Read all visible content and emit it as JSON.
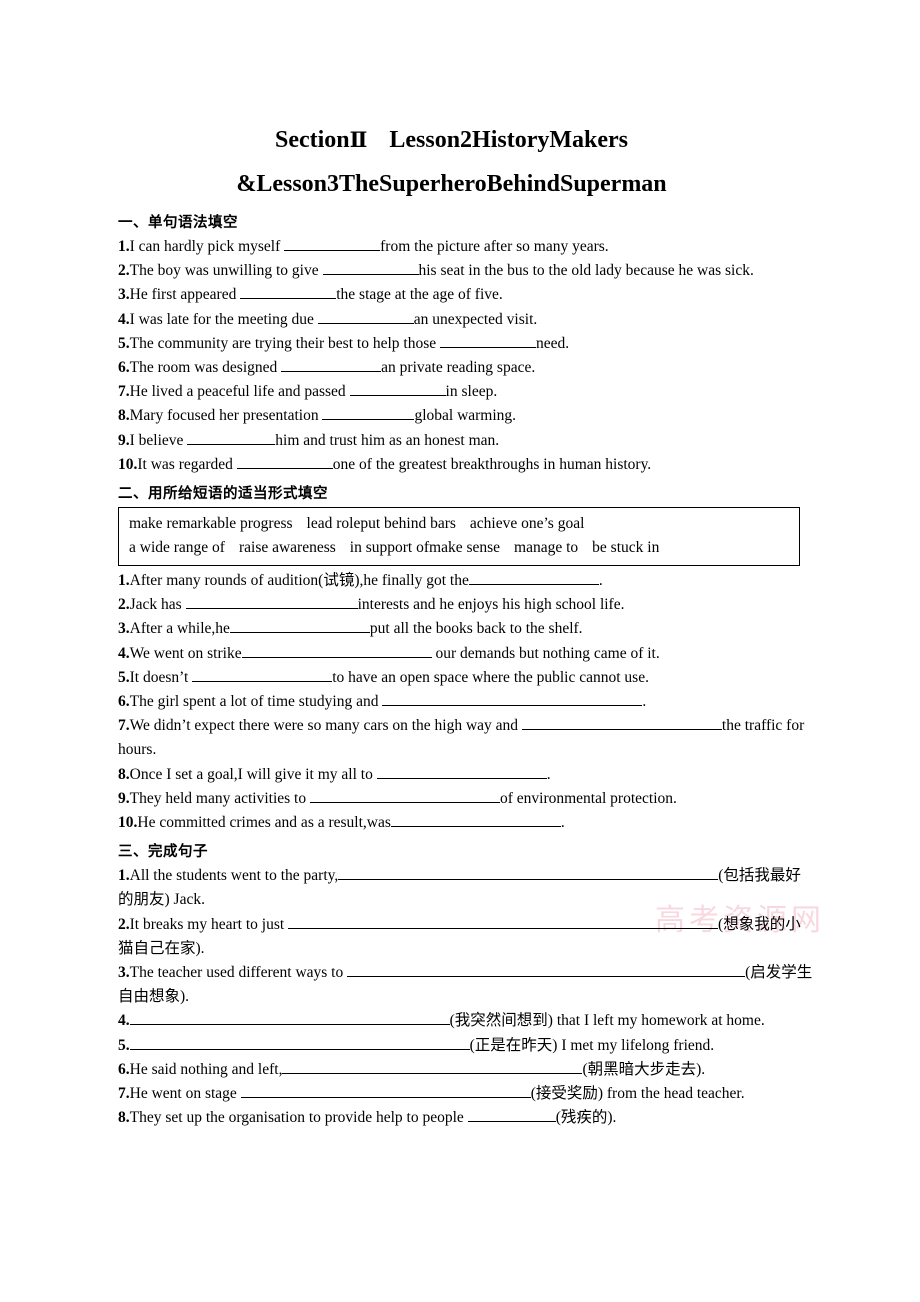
{
  "document": {
    "title_line1_prefix": "Section",
    "title_line1_roman": "Ⅱ",
    "title_line1_rest": "Lesson2HistoryMakers",
    "title_line2": "&Lesson3TheSuperheroBehindSuperman",
    "watermark_text": "高考资源网"
  },
  "section1": {
    "heading": "一、单句语法填空",
    "items": [
      {
        "num": "1.",
        "before": "I can hardly pick myself ",
        "blank_width": 96,
        "after": "from the picture after so many years."
      },
      {
        "num": "2.",
        "before": "The boy was unwilling to give ",
        "blank_width": 96,
        "after": "his seat in the bus to the old lady because he was sick."
      },
      {
        "num": "3.",
        "before": "He first appeared ",
        "blank_width": 96,
        "after": "the stage at the age of five."
      },
      {
        "num": "4.",
        "before": "I was late for the meeting due ",
        "blank_width": 96,
        "after": "an unexpected visit."
      },
      {
        "num": "5.",
        "before": "The community are trying their best to help those ",
        "blank_width": 96,
        "after": "need."
      },
      {
        "num": "6.",
        "before": "The room was designed ",
        "blank_width": 100,
        "after": "an private reading space."
      },
      {
        "num": "7.",
        "before": "He lived a peaceful life and passed ",
        "blank_width": 96,
        "after": "in sleep."
      },
      {
        "num": "8.",
        "before": "Mary focused her presentation ",
        "blank_width": 92,
        "after": "global warming."
      },
      {
        "num": "9.",
        "before": "I believe ",
        "blank_width": 88,
        "after": "him and trust him as an honest man."
      },
      {
        "num": "10.",
        "before": "It was regarded ",
        "blank_width": 96,
        "after": "one of the greatest breakthroughs in human history."
      }
    ]
  },
  "section2": {
    "heading": "二、用所给短语的适当形式填空",
    "wordbank": {
      "row1": [
        "make remarkable progress",
        "lead roleput behind bars",
        "achieve one’s goal"
      ],
      "row2": [
        "a wide range of",
        "raise awareness",
        "in support ofmake sense",
        "manage to",
        "be stuck in"
      ]
    },
    "items": [
      {
        "num": "1.",
        "before": "After many rounds of audition(试镜),he finally got the",
        "blank_width": 130,
        "after": "."
      },
      {
        "num": "2.",
        "before": "Jack has ",
        "blank_width": 172,
        "after": "interests and he enjoys his high school life."
      },
      {
        "num": "3.",
        "before": "After a while,he",
        "blank_width": 140,
        "after": "put all the books back to the shelf."
      },
      {
        "num": "4.",
        "before": "We went on strike",
        "blank_width": 190,
        "after": " our demands but nothing came of it."
      },
      {
        "num": "5.",
        "before": "It doesn’t ",
        "blank_width": 140,
        "after": "to have an open space where the public cannot use."
      },
      {
        "num": "6.",
        "before": "The girl spent a lot of time studying and ",
        "blank_width": 260,
        "after": "."
      },
      {
        "num": "7.",
        "before": "We didn’t expect there were so many cars on the high way and ",
        "blank_width": 200,
        "after": "the traffic for hours."
      },
      {
        "num": "8.",
        "before": "Once I set a goal,I will give it my all to ",
        "blank_width": 170,
        "after": "."
      },
      {
        "num": "9.",
        "before": "They held many activities to ",
        "blank_width": 190,
        "after": "of environmental protection."
      },
      {
        "num": "10.",
        "before": "He committed crimes and as a result,was",
        "blank_width": 170,
        "after": "."
      }
    ]
  },
  "section3": {
    "heading": "三、完成句子",
    "items": [
      {
        "num": "1.",
        "before": "All the students went to the party,",
        "blank_width": 380,
        "after": "(包括我最好的朋友) Jack."
      },
      {
        "num": "2.",
        "before": "It breaks my heart to just ",
        "blank_width": 430,
        "after": "(想象我的小猫自己在家)."
      },
      {
        "num": "3.",
        "before": "The teacher used different ways to ",
        "blank_width": 398,
        "after": "(启发学生自由想象)."
      },
      {
        "num": "4.",
        "before": "",
        "blank_width": 320,
        "after": "(我突然间想到) that I left my homework at home."
      },
      {
        "num": "5.",
        "before": "",
        "blank_width": 340,
        "after": "(正是在昨天) I met my lifelong friend."
      },
      {
        "num": "6.",
        "before": "He said nothing and left,",
        "blank_width": 300,
        "after": "(朝黑暗大步走去)."
      },
      {
        "num": "7.",
        "before": "He went on stage ",
        "blank_width": 290,
        "after": "(接受奖励) from the head teacher."
      },
      {
        "num": "8.",
        "before": "They set up the organisation to provide help to people ",
        "blank_width": 88,
        "after": "(残疾的)."
      }
    ]
  }
}
